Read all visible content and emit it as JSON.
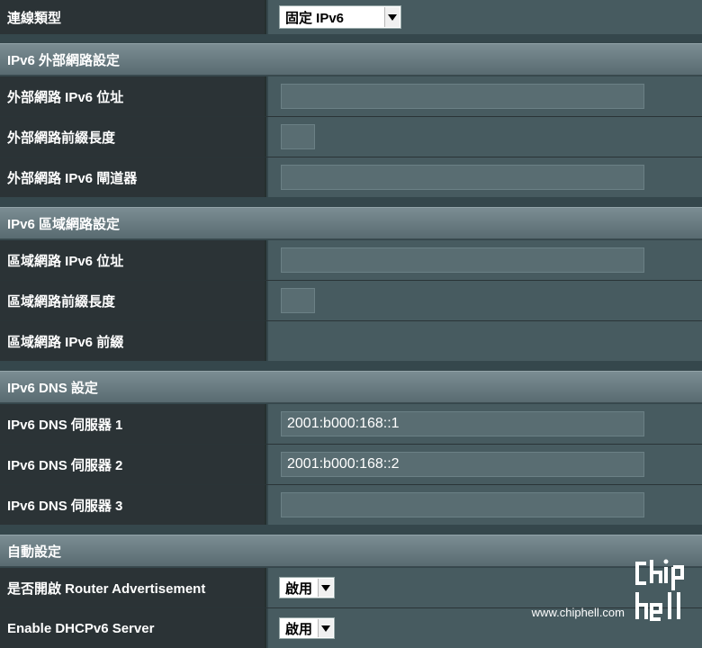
{
  "connection_type": {
    "label": "連線類型",
    "value": "固定 IPv6"
  },
  "wan_section": {
    "title": "IPv6 外部網路設定",
    "fields": [
      {
        "label": "外部網路 IPv6 位址",
        "value": ""
      },
      {
        "label": "外部網路前綴長度",
        "value": ""
      },
      {
        "label": "外部網路 IPv6 閘道器",
        "value": ""
      }
    ]
  },
  "lan_section": {
    "title": "IPv6 區域網路設定",
    "fields": [
      {
        "label": "區域網路 IPv6 位址",
        "value": ""
      },
      {
        "label": "區域網路前綴長度",
        "value": ""
      },
      {
        "label": "區域網路 IPv6 前綴",
        "value": ""
      }
    ]
  },
  "dns_section": {
    "title": "IPv6 DNS 設定",
    "fields": [
      {
        "label": "IPv6 DNS 伺服器 1",
        "value": "2001:b000:168::1"
      },
      {
        "label": "IPv6 DNS 伺服器 2",
        "value": "2001:b000:168::2"
      },
      {
        "label": "IPv6 DNS 伺服器 3",
        "value": ""
      }
    ]
  },
  "auto_section": {
    "title": "自動設定",
    "fields": [
      {
        "label": "是否開啟 Router Advertisement",
        "value": "啟用"
      },
      {
        "label": "Enable DHCPv6 Server",
        "value": "啟用"
      }
    ]
  },
  "watermark": {
    "url": "www.chiphell.com",
    "logo_text": "chip hell"
  },
  "colors": {
    "label_bg": "#2b3336",
    "value_bg": "#475b60",
    "section_bg": "#6d7f85",
    "input_bg": "#596d72"
  }
}
